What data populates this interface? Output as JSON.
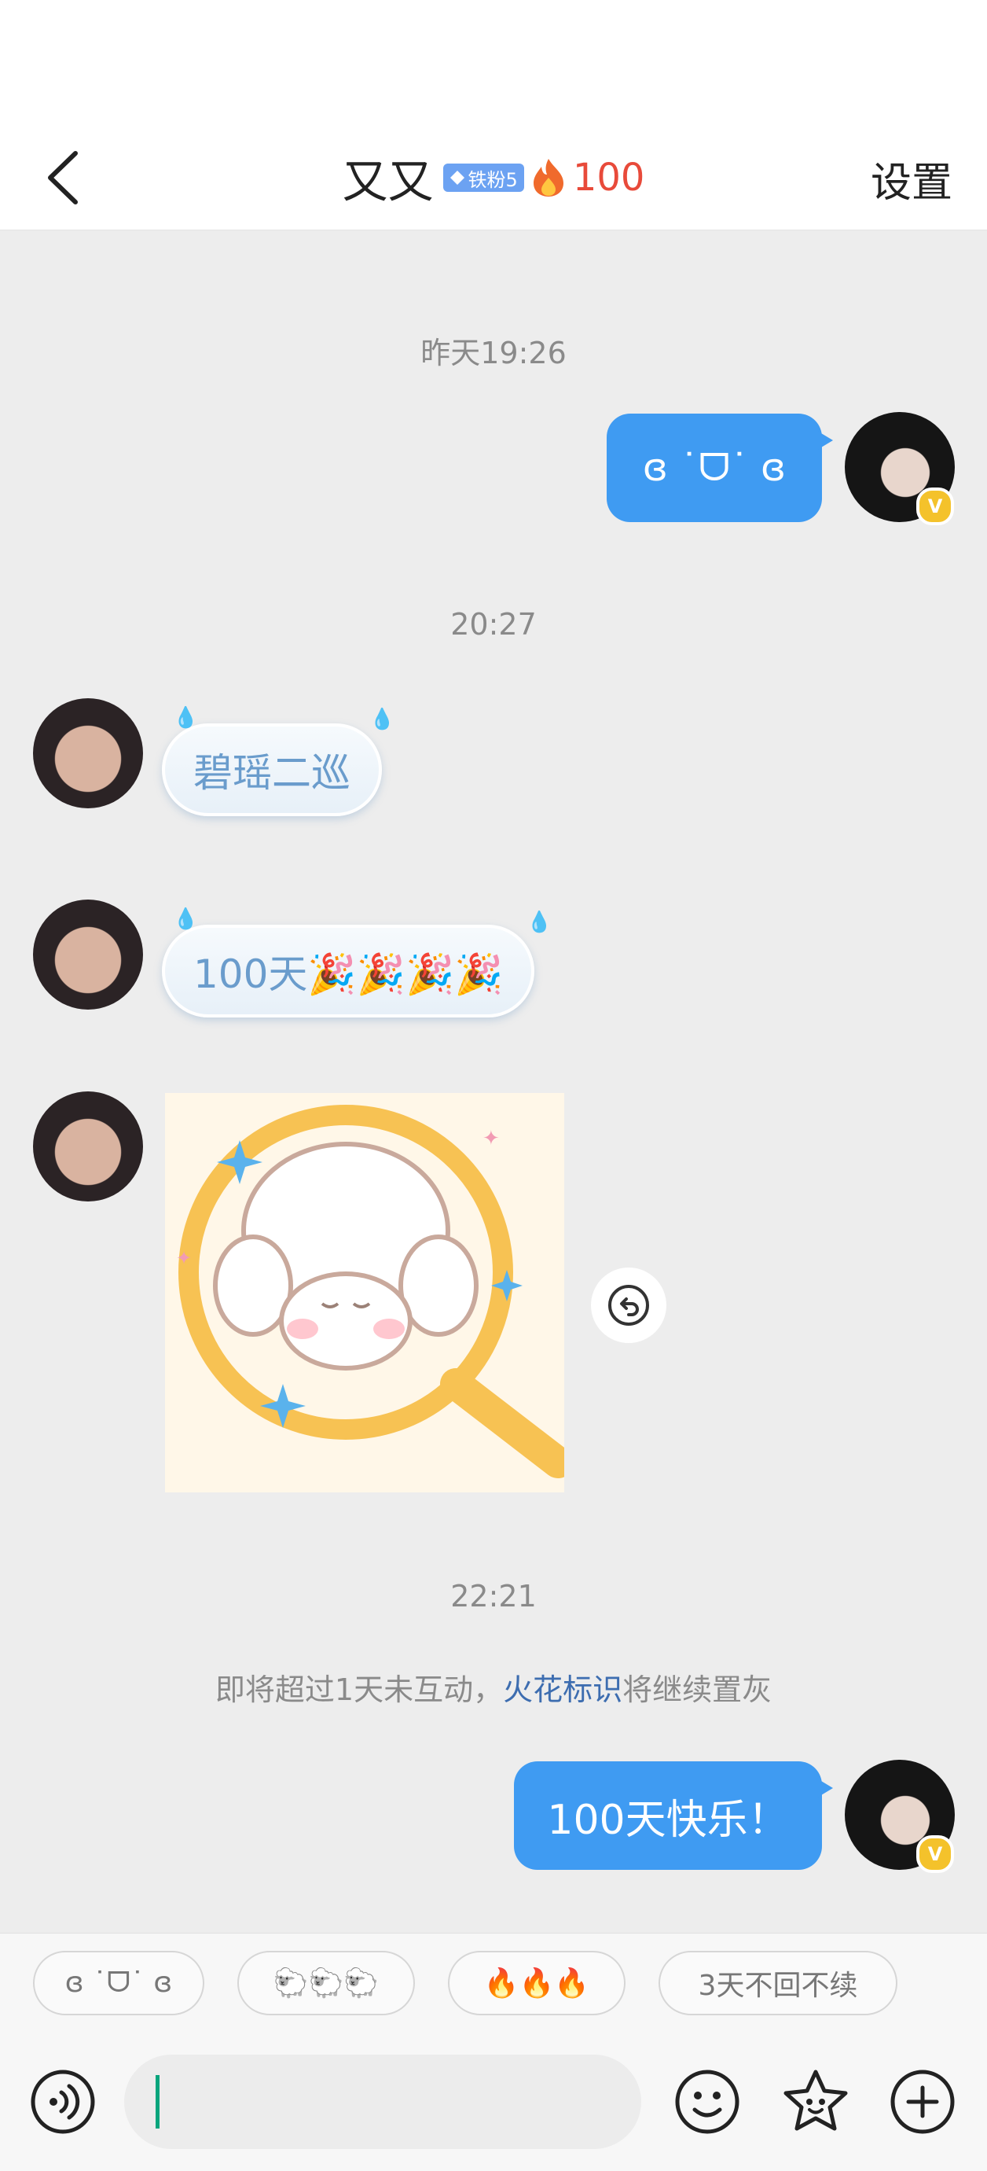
{
  "header": {
    "title": "又又",
    "fan_badge": "铁粉5",
    "streak_count": "100",
    "settings_label": "设置"
  },
  "messages": {
    "time_1": "昨天19:26",
    "msg_me_1": "ɞ ˙ᗜ˙ ɞ",
    "time_2": "20:27",
    "msg_friend_1": "碧瑶二巡",
    "msg_friend_2": "100天🎉🎉🎉🎉",
    "time_3": "22:21",
    "notice_prefix": "即将超过1天未互动，",
    "notice_link": "火花标识",
    "notice_suffix": "将继续置灰",
    "msg_me_2": "100天快乐！"
  },
  "quick_replies": [
    "ɞ ˙ᗜ˙ ɞ",
    "🐑🐑🐑",
    "🔥🔥🔥",
    "3天不回不续"
  ],
  "icons": {
    "back": "chevron-left-icon",
    "voice": "voice-icon",
    "emoji": "emoji-icon",
    "favorite": "star-face-icon",
    "add": "plus-icon",
    "reply": "reply-icon"
  },
  "colors": {
    "my_bubble": "#3f9bf2",
    "notice_link": "#3d6db0",
    "streak": "#e84a3a"
  }
}
